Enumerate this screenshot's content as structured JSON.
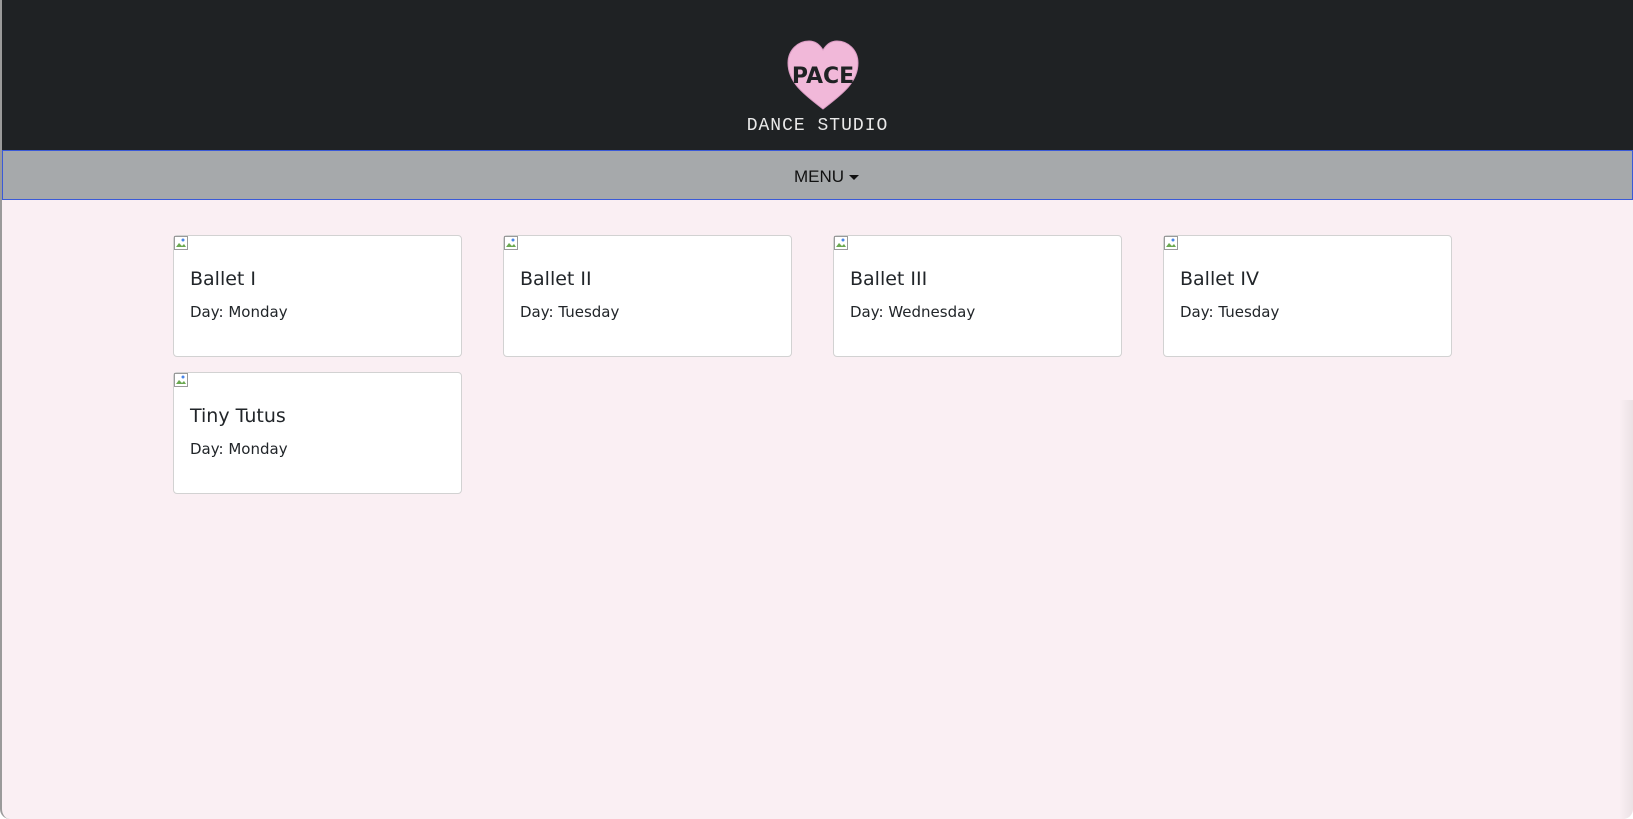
{
  "brand": {
    "logo_text": "PACE",
    "subtitle": "DANCE STUDIO",
    "logo_color": "#f1b8d9"
  },
  "navbar": {
    "menu_label": "MENU"
  },
  "classes": [
    {
      "title": "Ballet I",
      "day": "Day: Monday"
    },
    {
      "title": "Ballet II",
      "day": "Day: Tuesday"
    },
    {
      "title": "Ballet III",
      "day": "Day: Wednesday"
    },
    {
      "title": "Ballet IV",
      "day": "Day: Tuesday"
    },
    {
      "title": "Tiny Tutus",
      "day": "Day: Monday"
    }
  ],
  "colors": {
    "header_bg": "#1f2224",
    "navbar_bg": "#a6a9ab",
    "page_bg": "#faeff3",
    "card_bg": "#ffffff"
  }
}
